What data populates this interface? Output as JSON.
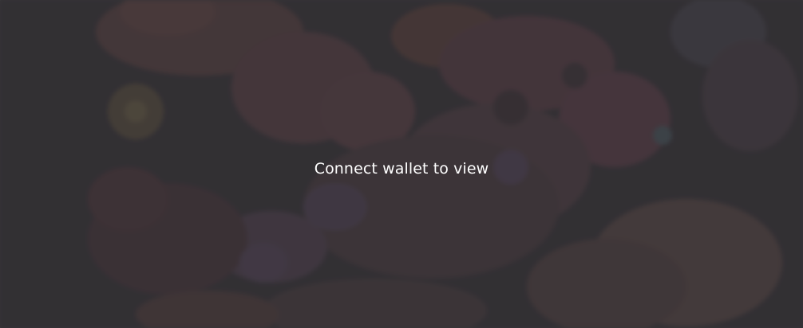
{
  "gated_content": {
    "message": "Connect wallet to view",
    "background_art": "blurred-3d-nft-artwork",
    "colors": {
      "overlay": "#343236",
      "text": "#ffffff",
      "accent_pink": "#8a4a55",
      "accent_orange": "#8b5038",
      "accent_purple": "#5b4660"
    }
  }
}
